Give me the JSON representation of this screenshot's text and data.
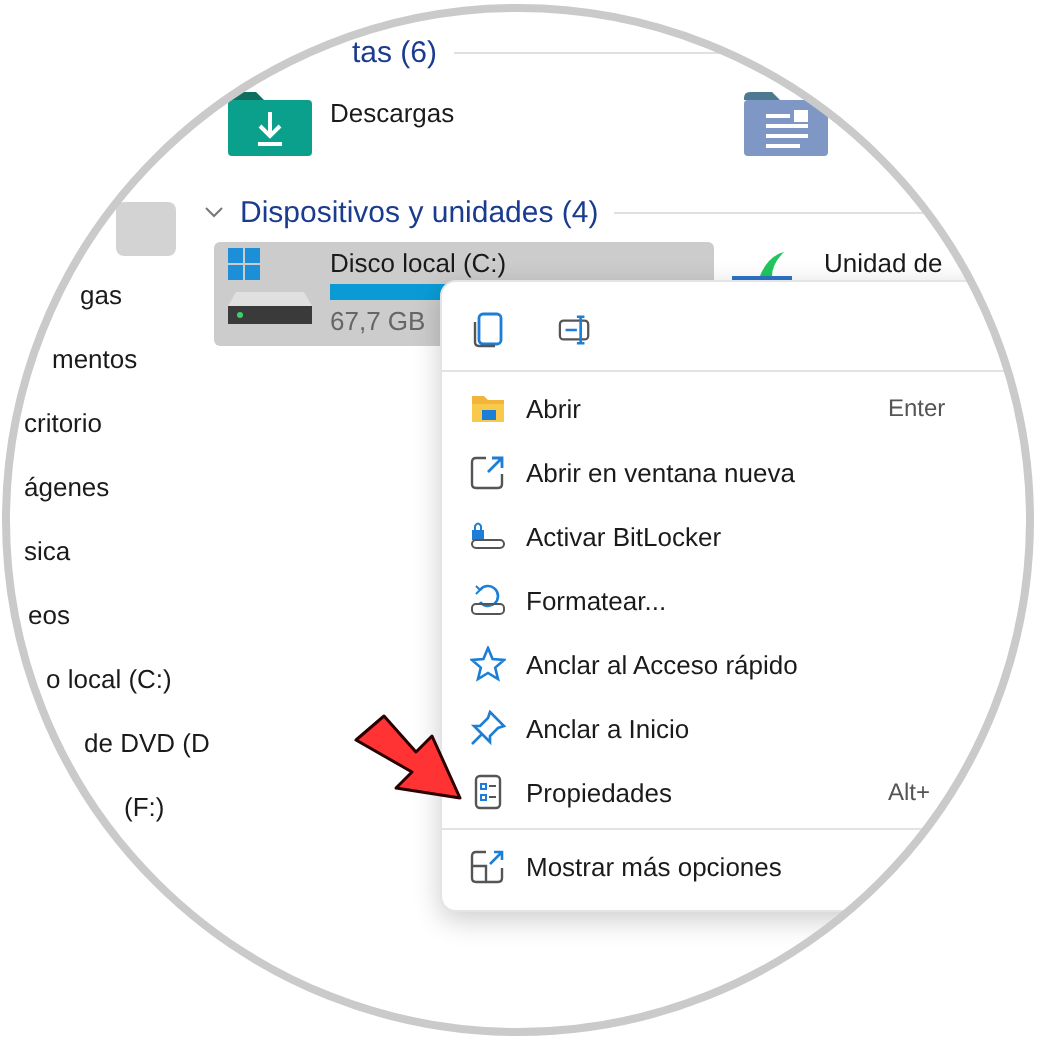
{
  "navigation": {
    "items": [
      {
        "selected": true
      },
      {
        "label": "gas",
        "selected": false
      },
      {
        "label": "mentos",
        "selected": false
      },
      {
        "label": "critorio",
        "selected": false
      },
      {
        "label": "ágenes",
        "selected": false
      },
      {
        "label": "sica",
        "selected": false
      },
      {
        "label": "eos",
        "selected": false
      },
      {
        "label": "o local (C:)",
        "selected": false
      },
      {
        "label": "de DVD (D",
        "selected": false
      },
      {
        "label": "(F:)",
        "selected": false
      }
    ]
  },
  "folders_section": {
    "title": "tas (6)",
    "items": [
      {
        "kind": "downloads",
        "name": "Descargas"
      },
      {
        "kind": "documents"
      }
    ]
  },
  "drives_section": {
    "title": "Dispositivos y unidades (4)",
    "expanded": true,
    "items": [
      {
        "kind": "system",
        "name": "Disco local (C:)",
        "detail": "67,7 GB",
        "selected": true
      },
      {
        "kind": "removable",
        "name": "Unidad de",
        "selected": false
      }
    ]
  },
  "context_menu": {
    "items": [
      {
        "label": "Abrir",
        "shortcut": "Enter"
      },
      {
        "label": "Abrir en ventana nueva"
      },
      {
        "label": "Activar BitLocker"
      },
      {
        "label": "Formatear..."
      },
      {
        "label": "Anclar al Acceso rápido"
      },
      {
        "label": "Anclar a Inicio"
      },
      {
        "label": "Propiedades",
        "shortcut": "Alt+"
      }
    ],
    "footer_item": {
      "label": "Mostrar más opciones"
    }
  }
}
